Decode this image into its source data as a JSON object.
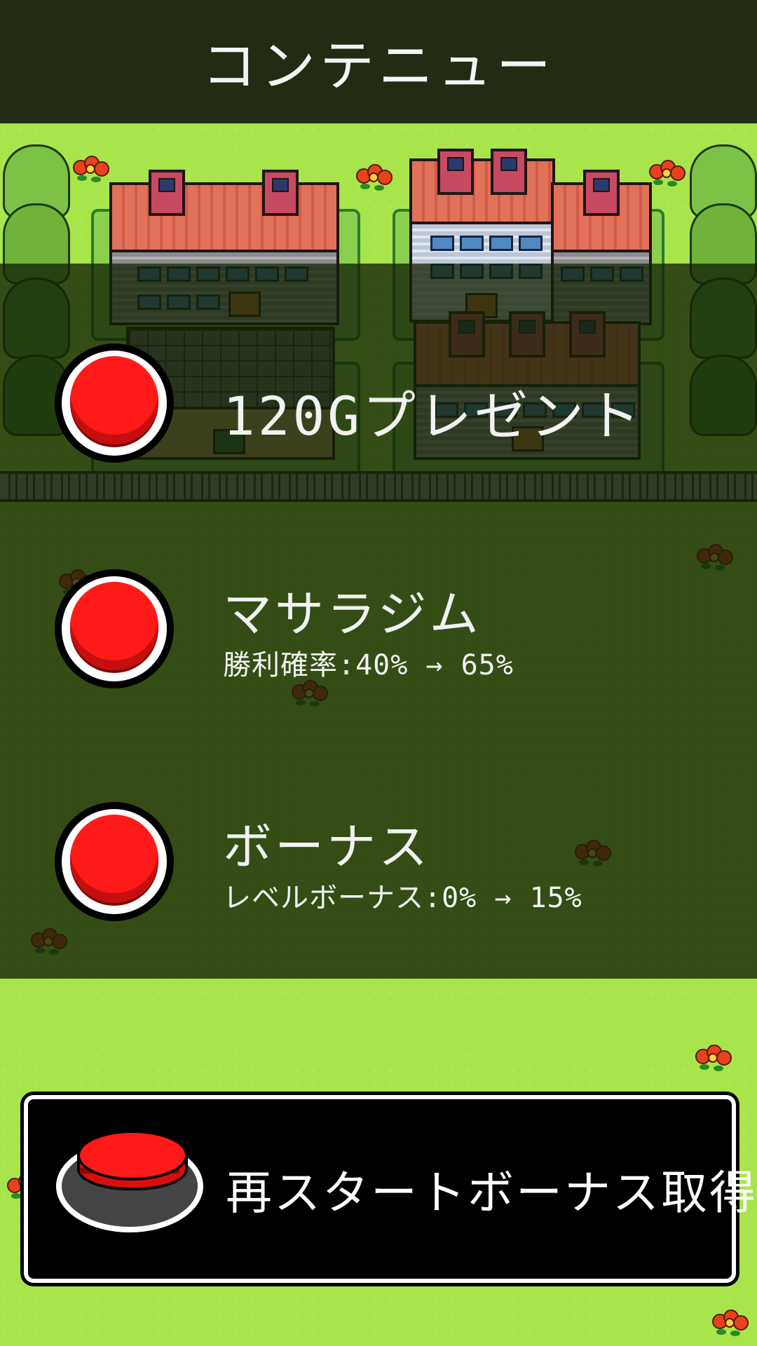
{
  "header": {
    "title": "コンテニュー"
  },
  "options": [
    {
      "id": "gold",
      "title": "120Gプレゼント",
      "subtitle": ""
    },
    {
      "id": "gym",
      "title": "マサラジム",
      "subtitle": "勝利確率:40% → 65%"
    },
    {
      "id": "bonus",
      "title": "ボーナス",
      "subtitle": "レベルボーナス:0% → 15%"
    }
  ],
  "start_button": {
    "label": "再スタートボーナス取得"
  },
  "colors": {
    "header_bg": "#222b14",
    "grass": "#a7e54a",
    "overlay": "#142206",
    "button_red": "#ff1a1a"
  }
}
